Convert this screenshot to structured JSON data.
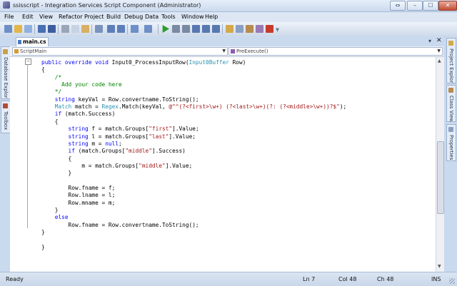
{
  "window": {
    "title": "ssisscript - Integration Services Script Component (Administrator)",
    "extra_button": "⇔",
    "minimize": "–",
    "maximize": "☐",
    "close": "✕"
  },
  "menu": [
    "File",
    "Edit",
    "View",
    "Refactor",
    "Project",
    "Build",
    "Debug",
    "Data",
    "Tools",
    "Window",
    "Help"
  ],
  "toolbar": {
    "icons": [
      "new-project-icon",
      "open-icon",
      "add-item-icon",
      "save-icon",
      "save-all-icon",
      "cut-icon",
      "copy-icon",
      "paste-icon",
      "find-icon",
      "comment-icon",
      "uncomment-icon",
      "undo-icon",
      "redo-icon",
      "start-debug-icon",
      "pause-icon",
      "stop-icon",
      "step-into-icon",
      "step-over-icon",
      "step-out-icon",
      "solution-explorer-icon",
      "properties-icon",
      "object-browser-icon",
      "toolbox-icon",
      "error-list-icon",
      "overflow-icon"
    ],
    "colors": {
      "accent": "#3a6fc4",
      "green": "#2e9b2e",
      "red": "#c73b2c"
    }
  },
  "left_panels": [
    "Database Explorer",
    "Toolbox"
  ],
  "right_panels": [
    "Project Explorer",
    "Class View",
    "Properties"
  ],
  "doc_tab": {
    "label": "main.cs",
    "dropdown": "▾",
    "close": "✕"
  },
  "navigation": {
    "class_dropdown": "ScriptMain",
    "member_dropdown": "PreExecute()",
    "arrow": "▼"
  },
  "code": {
    "lines": [
      [
        {
          "t": "public override void ",
          "c": "kw"
        },
        {
          "t": "Input0_ProcessInputRow(",
          "c": ""
        },
        {
          "t": "Input0Buffer",
          "c": "ty"
        },
        {
          "t": " Row)",
          "c": ""
        }
      ],
      [
        {
          "t": "{",
          "c": ""
        }
      ],
      [
        {
          "t": "    /*",
          "c": "cm"
        }
      ],
      [
        {
          "t": "      Add your code here",
          "c": "cm"
        }
      ],
      [
        {
          "t": "    */",
          "c": "cm"
        }
      ],
      [
        {
          "t": "    string ",
          "c": "kw"
        },
        {
          "t": "keyVal = Row.convertname.ToString();",
          "c": ""
        }
      ],
      [
        {
          "t": "    Match ",
          "c": "ty"
        },
        {
          "t": "match = ",
          "c": ""
        },
        {
          "t": "Regex",
          "c": "ty"
        },
        {
          "t": ".Match(keyVal, ",
          "c": ""
        },
        {
          "t": "@\"^(?<first>\\w+) (?<last>\\w+)(?: (?<middle>\\w+))?$\"",
          "c": "str"
        },
        {
          "t": ");",
          "c": ""
        }
      ],
      [
        {
          "t": "    if ",
          "c": "kw"
        },
        {
          "t": "(match.Success)",
          "c": ""
        }
      ],
      [
        {
          "t": "    {",
          "c": ""
        }
      ],
      [
        {
          "t": "        string ",
          "c": "kw"
        },
        {
          "t": "f = match.Groups[",
          "c": ""
        },
        {
          "t": "\"first\"",
          "c": "str"
        },
        {
          "t": "].Value;",
          "c": ""
        }
      ],
      [
        {
          "t": "        string ",
          "c": "kw"
        },
        {
          "t": "l = match.Groups[",
          "c": ""
        },
        {
          "t": "\"last\"",
          "c": "str"
        },
        {
          "t": "].Value;",
          "c": ""
        }
      ],
      [
        {
          "t": "        string ",
          "c": "kw"
        },
        {
          "t": "m = ",
          "c": ""
        },
        {
          "t": "null",
          "c": "kw"
        },
        {
          "t": ";",
          "c": ""
        }
      ],
      [
        {
          "t": "        if ",
          "c": "kw"
        },
        {
          "t": "(match.Groups[",
          "c": ""
        },
        {
          "t": "\"middle\"",
          "c": "str"
        },
        {
          "t": "].Success)",
          "c": ""
        }
      ],
      [
        {
          "t": "        {",
          "c": ""
        }
      ],
      [
        {
          "t": "            m = match.Groups[",
          "c": ""
        },
        {
          "t": "\"middle\"",
          "c": "str"
        },
        {
          "t": "].Value;",
          "c": ""
        }
      ],
      [
        {
          "t": "        }",
          "c": ""
        }
      ],
      [
        {
          "t": "",
          "c": ""
        }
      ],
      [
        {
          "t": "        Row.fname = f;",
          "c": ""
        }
      ],
      [
        {
          "t": "        Row.lname = l;",
          "c": ""
        }
      ],
      [
        {
          "t": "        Row.mname = m;",
          "c": ""
        }
      ],
      [
        {
          "t": "    }",
          "c": ""
        }
      ],
      [
        {
          "t": "    else",
          "c": "kw"
        }
      ],
      [
        {
          "t": "        Row.fname = Row.convertname.ToString();",
          "c": ""
        }
      ],
      [
        {
          "t": "}",
          "c": ""
        }
      ],
      [
        {
          "t": "",
          "c": ""
        }
      ],
      [
        {
          "t": "}",
          "c": ""
        }
      ]
    ],
    "colors": {
      "keyword": "#0000ff",
      "type": "#2b91af",
      "string": "#a31515",
      "comment": "#008000"
    }
  },
  "status": {
    "text": "Ready",
    "line": "Ln 7",
    "col": "Col 48",
    "ch": "Ch 48",
    "mode": "INS"
  }
}
